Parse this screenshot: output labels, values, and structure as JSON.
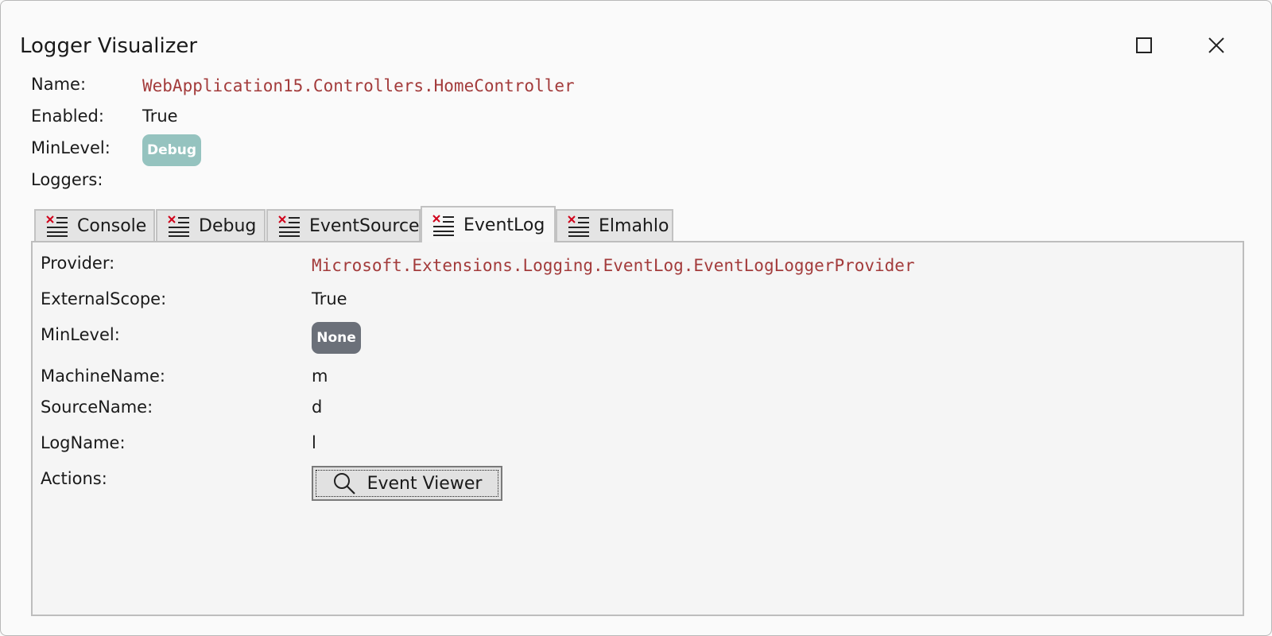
{
  "window": {
    "title": "Logger Visualizer",
    "maximize_icon": "maximize-icon",
    "close_icon": "close-icon"
  },
  "logger": {
    "name_label": "Name:",
    "name_value": "WebApplication15.Controllers.HomeController",
    "enabled_label": "Enabled:",
    "enabled_value": "True",
    "minlevel_label": "MinLevel:",
    "minlevel_value": "Debug",
    "minlevel_color": "#95c3bf",
    "loggers_label": "Loggers:"
  },
  "tabs": [
    {
      "label": "Console",
      "icon": "logger-list-icon"
    },
    {
      "label": "Debug",
      "icon": "logger-list-icon"
    },
    {
      "label": "EventSource",
      "icon": "logger-list-icon"
    },
    {
      "label": "EventLog",
      "icon": "logger-list-icon",
      "selected": true
    },
    {
      "label": "Elmahlo",
      "icon": "logger-list-icon"
    }
  ],
  "eventlog": {
    "provider_label": "Provider:",
    "provider_value": "Microsoft.Extensions.Logging.EventLog.EventLogLoggerProvider",
    "externalscope_label": "ExternalScope:",
    "externalscope_value": "True",
    "minlevel_label": "MinLevel:",
    "minlevel_value": "None",
    "minlevel_color": "#6b7079",
    "machinename_label": "MachineName:",
    "machinename_value": "m",
    "sourcename_label": "SourceName:",
    "sourcename_value": "d",
    "logname_label": "LogName:",
    "logname_value": "l",
    "actions_label": "Actions:",
    "event_viewer_label": "Event Viewer",
    "event_viewer_icon": "search-icon"
  },
  "colors": {
    "mono_value": "#a33b3b",
    "icon_red": "#d0021b"
  }
}
